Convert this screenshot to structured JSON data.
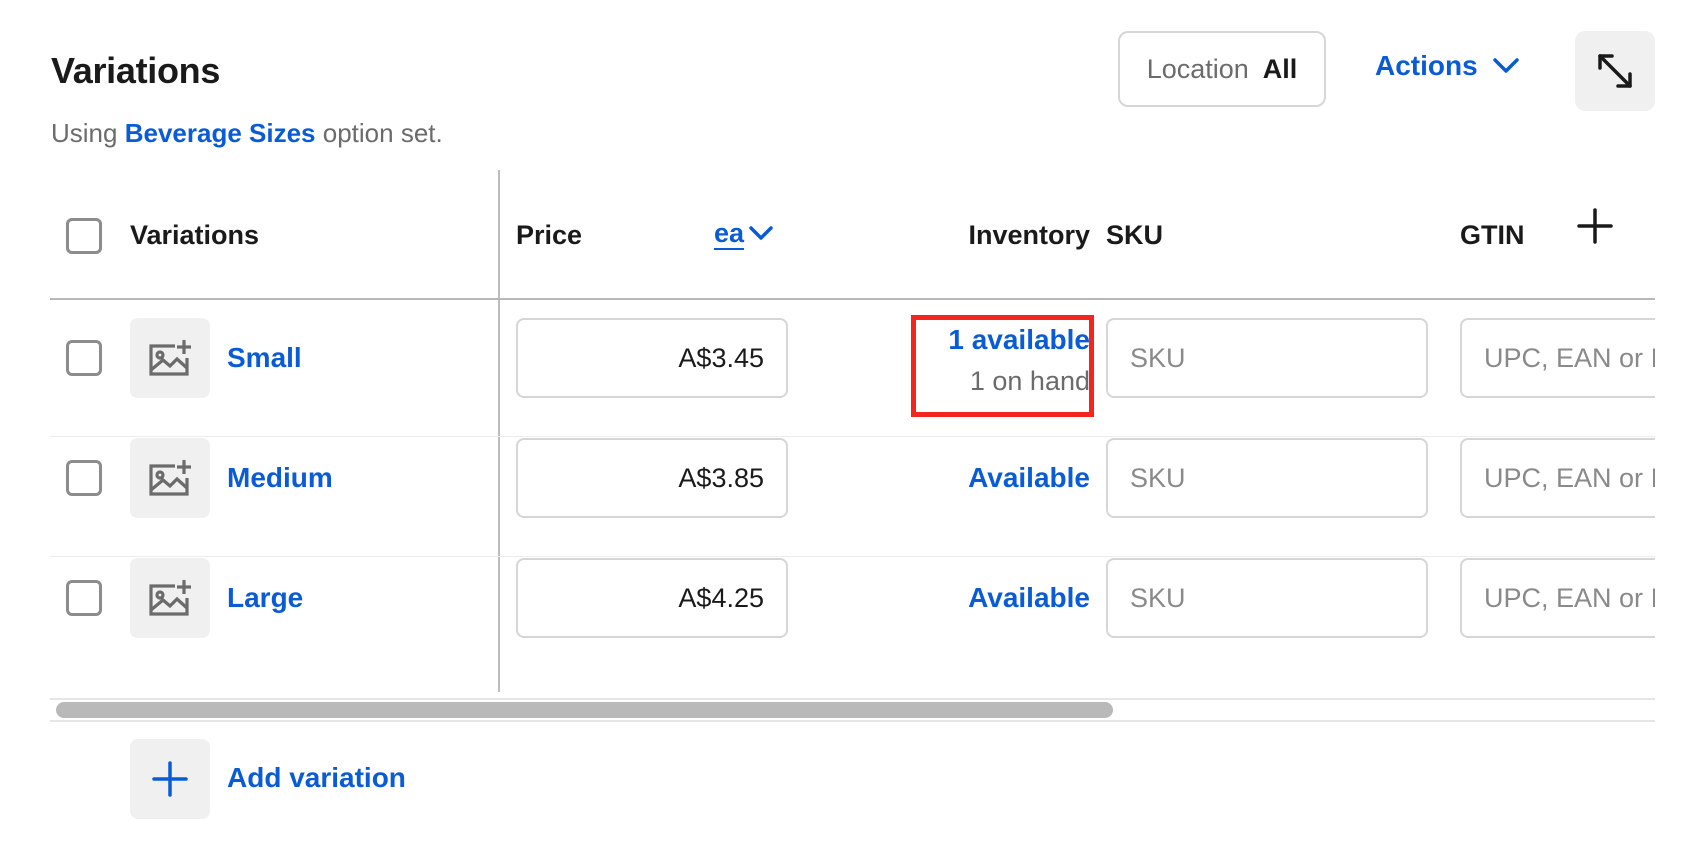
{
  "header": {
    "title": "Variations",
    "subtitle_prefix": "Using",
    "subtitle_link": "Beverage Sizes",
    "subtitle_suffix": "option set.",
    "location_label": "Location",
    "location_value": "All",
    "actions_label": "Actions",
    "expand_icon": "expand-arrows-icon"
  },
  "table": {
    "columns": {
      "variations": "Variations",
      "price": "Price",
      "unit": "ea",
      "inventory": "Inventory",
      "sku": "SKU",
      "gtin": "GTIN"
    },
    "rows": [
      {
        "name": "Small",
        "price": "A$3.45",
        "inventory_main": "1 available",
        "inventory_sub": "1 on hand",
        "sku_placeholder": "SKU",
        "gtin_placeholder": "UPC, EAN or ISBN"
      },
      {
        "name": "Medium",
        "price": "A$3.85",
        "inventory_main": "Available",
        "inventory_sub": "",
        "sku_placeholder": "SKU",
        "gtin_placeholder": "UPC, EAN or ISBN"
      },
      {
        "name": "Large",
        "price": "A$4.25",
        "inventory_main": "Available",
        "inventory_sub": "",
        "sku_placeholder": "SKU",
        "gtin_placeholder": "UPC, EAN or ISBN"
      }
    ],
    "scroll_fraction_visible": 0.66
  },
  "footer": {
    "add_variation_label": "Add variation"
  },
  "colors": {
    "link_blue": "#0a5cd6",
    "highlight_red": "#f2261e"
  }
}
